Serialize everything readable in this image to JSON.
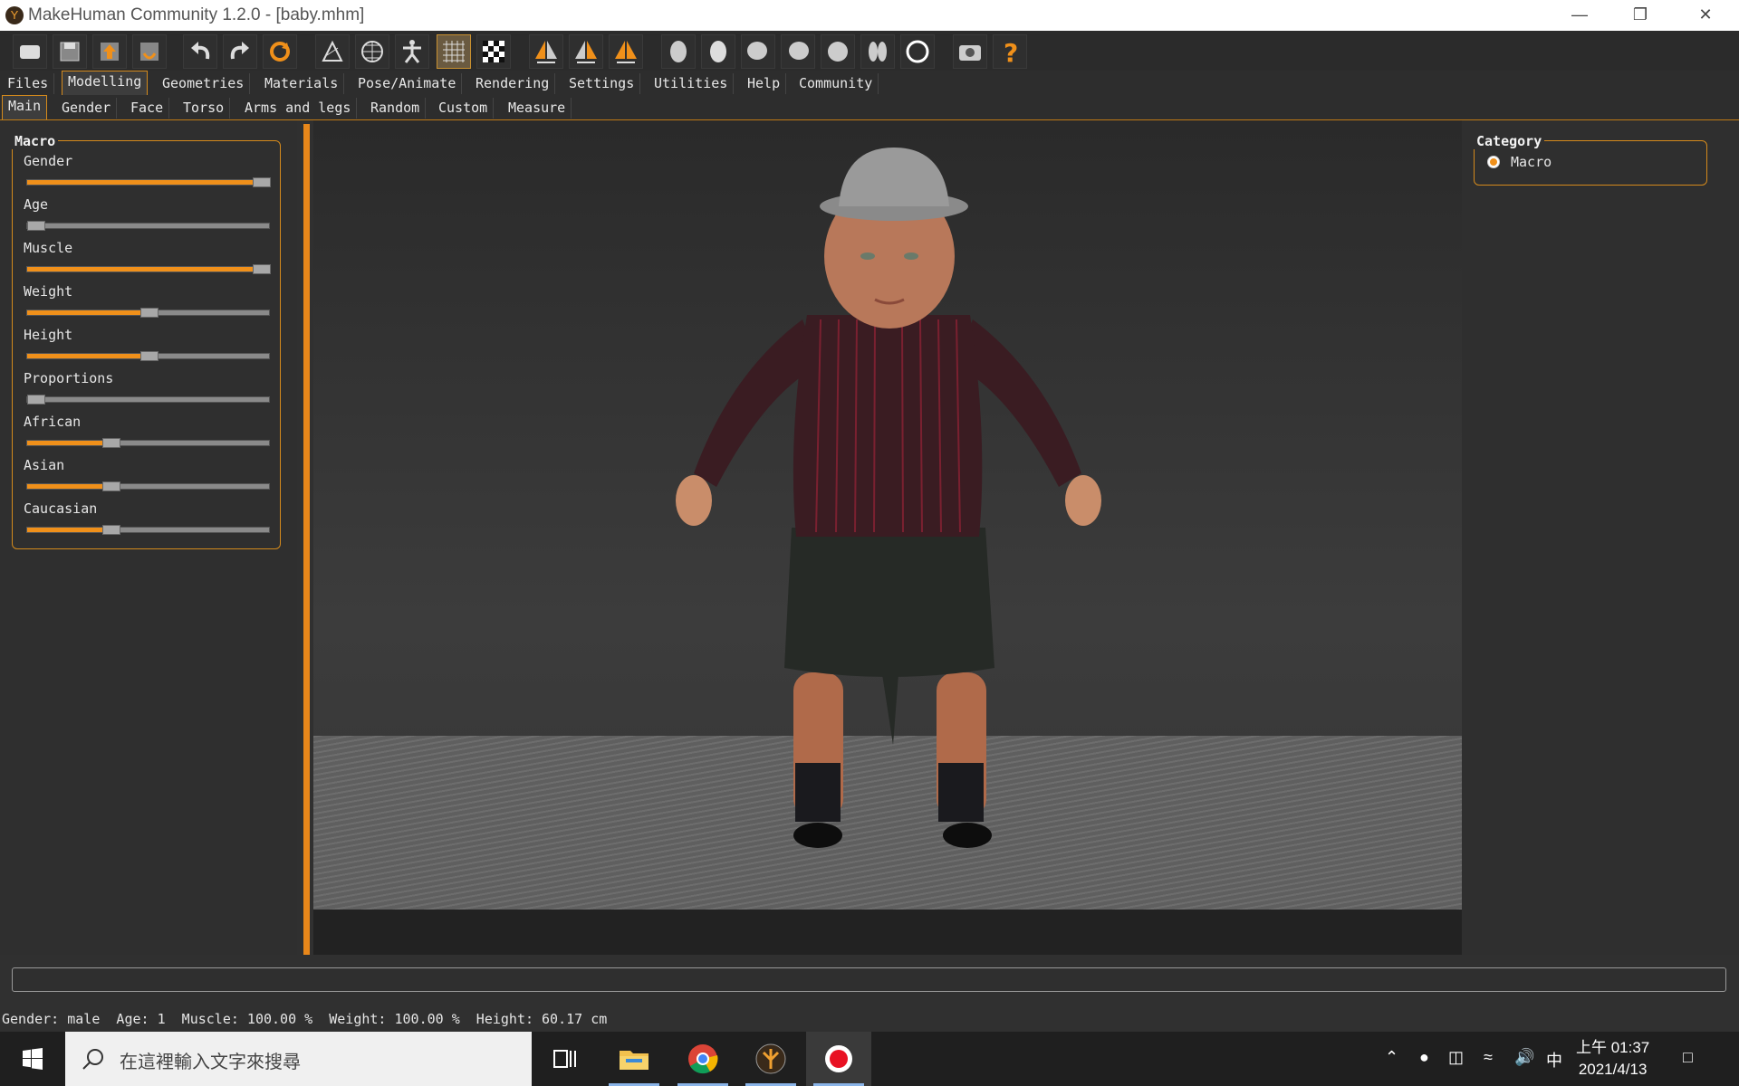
{
  "window": {
    "title": "MakeHuman Community 1.2.0 - [baby.mhm]",
    "controls": [
      "minimize-icon",
      "restore-icon",
      "close-icon"
    ]
  },
  "toolbar": {
    "icons": [
      "load-icon",
      "save-icon",
      "export-icon",
      "exit-icon",
      "undo-icon",
      "redo-icon",
      "reset-icon",
      "smooth-icon",
      "wireframe-icon",
      "pose-icon",
      "grid-icon",
      "background-icon",
      "symmetry-right-icon",
      "symmetry-left-icon",
      "symmetry-icon",
      "front-view-icon",
      "back-view-icon",
      "left-view-icon",
      "right-view-icon",
      "top-view-icon",
      "bottom-view-icon",
      "reset-camera-icon",
      "screenshot-icon",
      "help-icon"
    ],
    "selected": "grid-icon"
  },
  "menu_tabs": [
    "Files",
    "Modelling",
    "Geometries",
    "Materials",
    "Pose/Animate",
    "Rendering",
    "Settings",
    "Utilities",
    "Help",
    "Community"
  ],
  "active_menu_tab": "Modelling",
  "sub_tabs": [
    "Main",
    "Gender",
    "Face",
    "Torso",
    "Arms and legs",
    "Random",
    "Custom",
    "Measure"
  ],
  "active_sub_tab": "Main",
  "macro_panel": {
    "title": "Macro",
    "sliders": [
      {
        "label": "Gender",
        "value": 1.0
      },
      {
        "label": "Age",
        "value": 0.0
      },
      {
        "label": "Muscle",
        "value": 1.0
      },
      {
        "label": "Weight",
        "value": 0.5
      },
      {
        "label": "Height",
        "value": 0.5
      },
      {
        "label": "Proportions",
        "value": 0.0
      },
      {
        "label": "African",
        "value": 0.333
      },
      {
        "label": "Asian",
        "value": 0.333
      },
      {
        "label": "Caucasian",
        "value": 0.333
      }
    ]
  },
  "category_panel": {
    "title": "Category",
    "options": [
      "Macro"
    ],
    "selected": "Macro"
  },
  "status_bar": "Gender: male  Age: 1  Muscle: 100.00 %  Weight: 100.00 %  Height: 60.17 cm",
  "taskbar": {
    "search_placeholder": "在這裡輸入文字來搜尋",
    "apps": [
      "task-view-icon",
      "file-explorer-icon",
      "chrome-icon",
      "makehuman-icon",
      "record-icon"
    ],
    "ime": "中",
    "time": "上午 01:37",
    "date": "2021/4/13"
  },
  "colors": {
    "accent": "#f0901a",
    "panel": "#2f2f2f",
    "viewport": "#353535"
  }
}
